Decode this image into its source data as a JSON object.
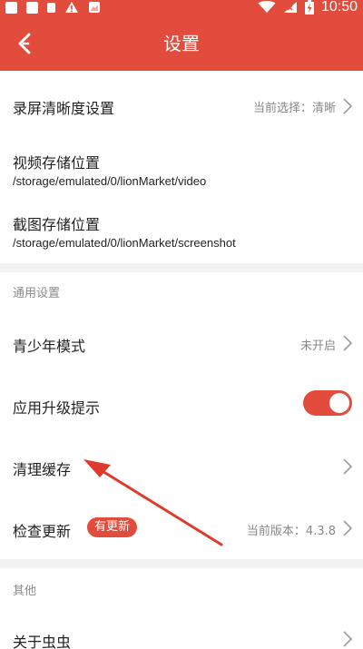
{
  "status_bar": {
    "time": "10:50",
    "battery_icon_text": "⚡"
  },
  "header": {
    "title": "设置"
  },
  "settings": {
    "record_quality": {
      "label": "录屏清晰度设置",
      "value": "当前选择：清晰"
    },
    "video_storage": {
      "label": "视频存储位置",
      "path": "/storage/emulated/0/lionMarket/video"
    },
    "screenshot_storage": {
      "label": "截图存储位置",
      "path": "/storage/emulated/0/lionMarket/screenshot"
    }
  },
  "general": {
    "section_label": "通用设置",
    "teen_mode": {
      "label": "青少年模式",
      "value": "未开启"
    },
    "upgrade_prompt": {
      "label": "应用升级提示",
      "enabled": true
    },
    "clear_cache": {
      "label": "清理缓存"
    },
    "check_update": {
      "label": "检查更新",
      "badge": "有更新",
      "value": "当前版本：4.3.8"
    }
  },
  "other": {
    "section_label": "其他",
    "about": {
      "label": "关于虫虫"
    }
  },
  "colors": {
    "brand": "#e24c3c",
    "divider_bg": "#f2f2f2"
  }
}
